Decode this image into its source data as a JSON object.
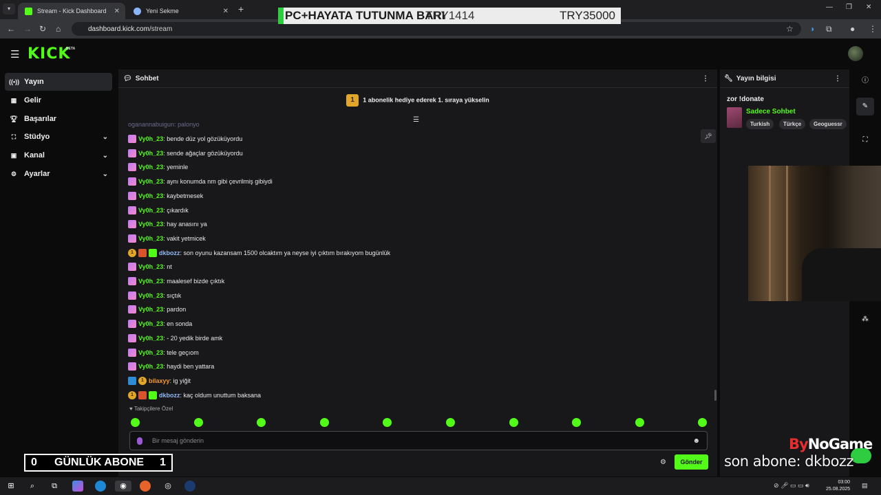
{
  "browser": {
    "tabs": [
      {
        "title": "Stream - Kick Dashboard",
        "active": true
      },
      {
        "title": "Yeni Sekme",
        "active": false
      }
    ],
    "url_host": "dashboard.kick.com",
    "url_path": "/stream"
  },
  "overlay_banner": {
    "left": "PC+HAYATA TUTUNMA BARI",
    "middle": "TRY1414",
    "right": "TRY35000"
  },
  "header": {
    "logo": "KICK",
    "logo_badge": "BETA"
  },
  "sidebar": {
    "items": [
      {
        "label": "Yayın",
        "icon": "broadcast-icon"
      },
      {
        "label": "Gelir",
        "icon": "revenue-icon"
      },
      {
        "label": "Başarılar",
        "icon": "trophy-icon"
      },
      {
        "label": "Stüdyo",
        "icon": "studio-icon"
      },
      {
        "label": "Kanal",
        "icon": "channel-icon"
      },
      {
        "label": "Ayarlar",
        "icon": "settings-icon"
      }
    ]
  },
  "chat": {
    "title": "Sohbet",
    "promo": "1 abonelik hediye ederek 1. sıraya yükselin",
    "promo_rank": "1",
    "partial_line": "oganannabuigun: palonyo",
    "messages": [
      {
        "user": "Vy0h_23",
        "text": ": bende düz yol gözüküyordu"
      },
      {
        "user": "Vy0h_23",
        "text": ": sende ağaçlar gözüküyordu"
      },
      {
        "user": "Vy0h_23",
        "text": ": yeminle"
      },
      {
        "user": "Vy0h_23",
        "text": ": aynı konumda nm gibi çevrilmiş gibiydi"
      },
      {
        "user": "Vy0h_23",
        "text": ": kaybetmesek"
      },
      {
        "user": "Vy0h_23",
        "text": ": çıkardık"
      },
      {
        "user": "Vy0h_23",
        "text": ": hay anasını ya"
      },
      {
        "user": "Vy0h_23",
        "text": ": vakit yetmicek"
      },
      {
        "user": "dkbozz",
        "text": ": son oyunu kazansam 1500 olcaktım ya neyse iyi çıktım bırakıyom bugünlük"
      },
      {
        "user": "Vy0h_23",
        "text": ": nt"
      },
      {
        "user": "Vy0h_23",
        "text": ": maalesef bizde çıktık"
      },
      {
        "user": "Vy0h_23",
        "text": ": sıçtık"
      },
      {
        "user": "Vy0h_23",
        "text": ": pardon"
      },
      {
        "user": "Vy0h_23",
        "text": ": en sonda"
      },
      {
        "user": "Vy0h_23",
        "text": ": - 20 yedik birde amk"
      },
      {
        "user": "Vy0h_23",
        "text": ": tele geçıom"
      },
      {
        "user": "Vy0h_23",
        "text": ": haydi ben yattara"
      },
      {
        "user": "bilaxyy",
        "text": ": ig yiğit"
      },
      {
        "user": "dkbozz",
        "text": ": kaç oldum unuttum baksana"
      }
    ],
    "followers_only_label": "Takipçilere Özel",
    "input_placeholder": "Bir mesaj gönderin",
    "send_label": "Gönder"
  },
  "stream_info": {
    "title": "Yayın bilgisi",
    "stream_title": "zor !donate",
    "category": "Sadece Sohbet",
    "tags": [
      "Turkish",
      "Türkçe",
      "Geoguessr"
    ]
  },
  "overlays": {
    "sub_counter_left": "0",
    "sub_counter_label": "GÜNLÜK ABONE",
    "sub_counter_right": "1",
    "brand_mark": "By",
    "brand_rest": "NoGame",
    "last_sub": "son abone: dkbozz"
  },
  "taskbar": {
    "time": "03:00",
    "date": "25.08.2025"
  },
  "colors": {
    "kick_green": "#53fc18",
    "panel_bg": "#18181b",
    "page_bg": "#0b0b0c",
    "gift_badge": "#c07bf3",
    "username_green": "#53fc18",
    "username_blue": "#93b8f5",
    "username_orange": "#f59a2a"
  }
}
